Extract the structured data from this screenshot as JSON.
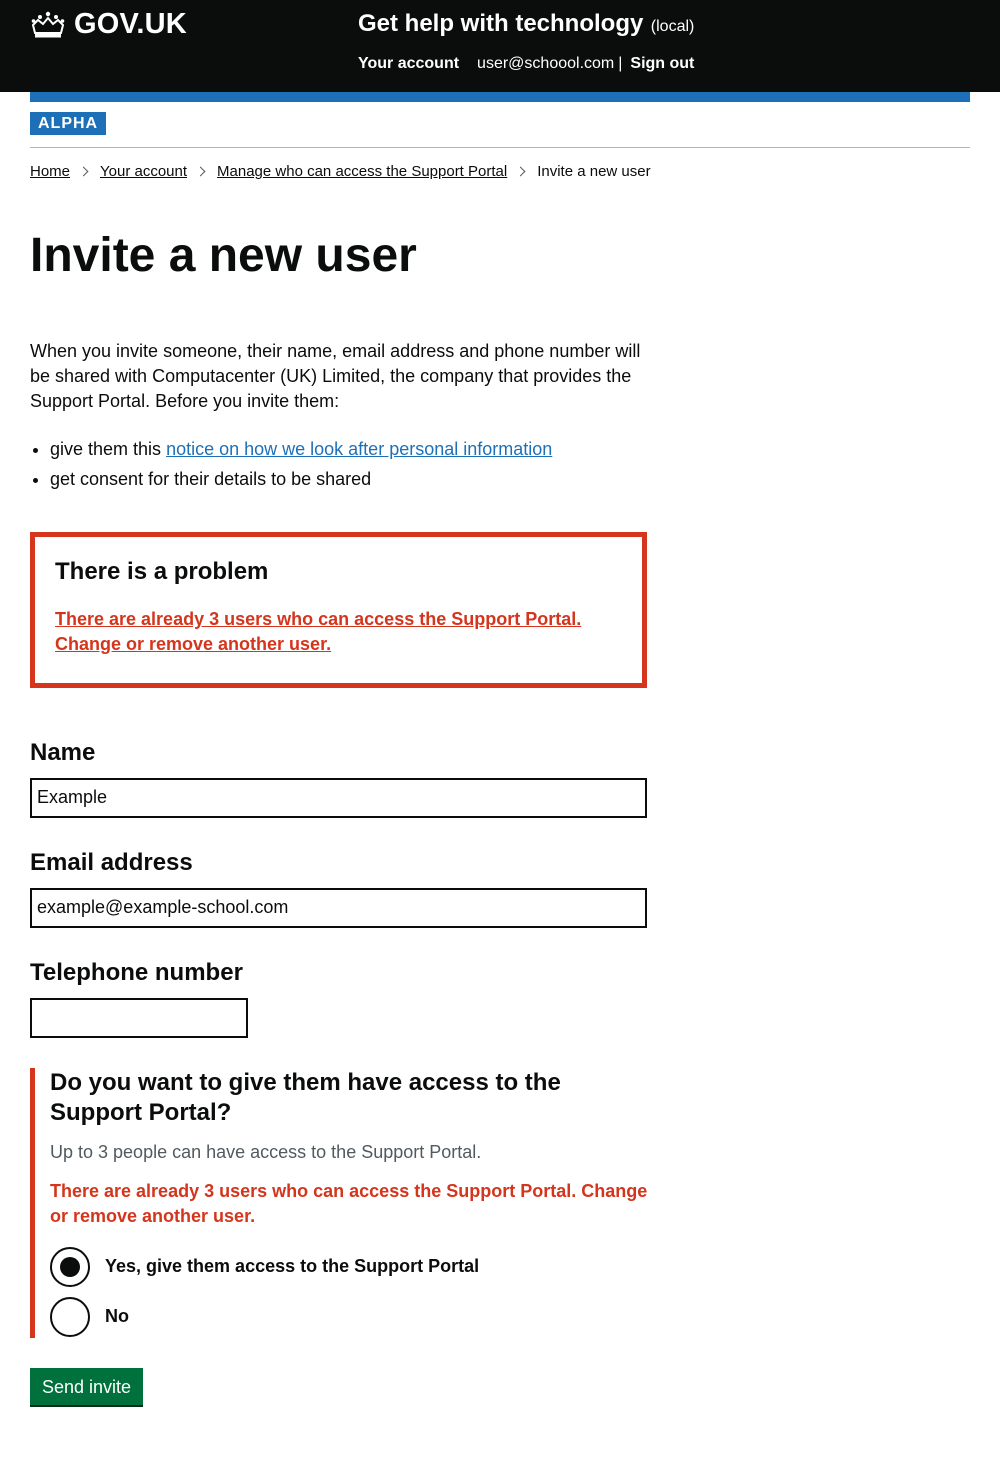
{
  "header": {
    "logo_text": "GOV.UK",
    "service_name": "Get help with technology",
    "environment": "(local)",
    "nav": {
      "account": "Your account",
      "email": "user@schoool.com",
      "separator": "|",
      "sign_out": "Sign out"
    }
  },
  "phase": {
    "tag": "ALPHA"
  },
  "breadcrumbs": {
    "items": [
      "Home",
      "Your account",
      "Manage who can access the Support Portal"
    ],
    "current": "Invite a new user"
  },
  "page": {
    "title": "Invite a new user",
    "intro": "When you invite someone, their name, email address and phone number will be shared with Computacenter (UK) Limited, the company that provides the Support Portal. Before you invite them:",
    "bullets": {
      "item1_prefix": "give them this ",
      "item1_link": "notice on how we look after personal information",
      "item2": "get consent for their details to be shared"
    }
  },
  "error_summary": {
    "title": "There is a problem",
    "link": "There are already 3 users who can access the Support Portal. Change or remove another user."
  },
  "form": {
    "name": {
      "label": "Name",
      "value": "Example"
    },
    "email": {
      "label": "Email address",
      "value": "example@example-school.com"
    },
    "telephone": {
      "label": "Telephone number",
      "value": ""
    },
    "access": {
      "legend": "Do you want to give them have access to the Support Portal?",
      "hint": "Up to 3 people can have access to the Support Portal.",
      "error": "There are already 3 users who can access the Support Portal. Change or remove another user.",
      "options": [
        {
          "label": "Yes, give them access to the Support Portal",
          "checked": true
        },
        {
          "label": "No",
          "checked": false
        }
      ]
    },
    "submit": "Send invite"
  },
  "colors": {
    "header_bg": "#0b0c0c",
    "brand_blue": "#1d70b8",
    "error_red": "#d4351c",
    "button_green": "#00703c",
    "hint_grey": "#505a5f"
  },
  "icons": {
    "logo": "crown-icon",
    "breadcrumb_separator": "chevron-right-icon"
  }
}
